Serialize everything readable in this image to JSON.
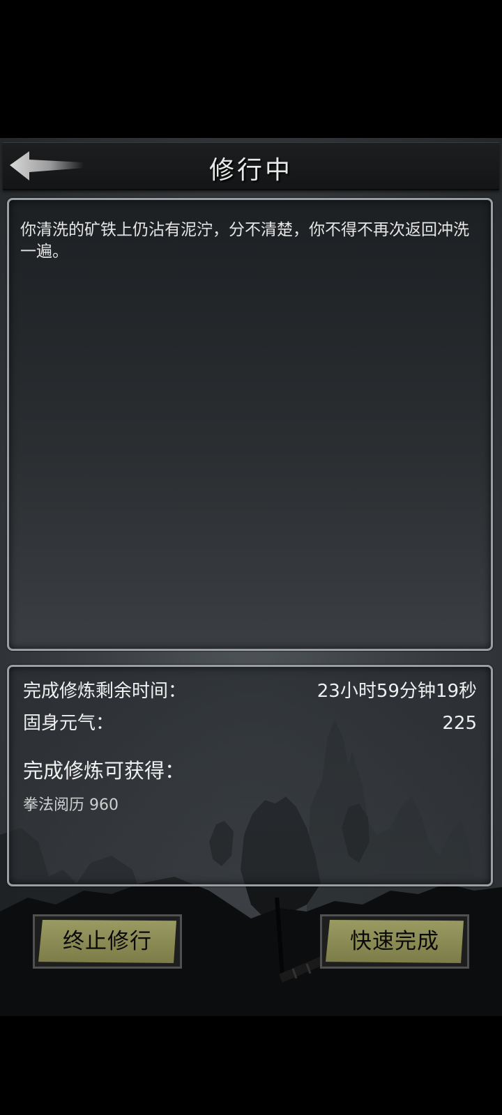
{
  "header": {
    "title": "修行中",
    "back_icon": "back-arrow-icon"
  },
  "story": {
    "text": "你清洗的矿铁上仍沾有泥泞，分不清楚，你不得不再次返回冲洗一遍。"
  },
  "status": {
    "time_label": "完成修炼剩余时间：",
    "time_value": "23小时59分钟19秒",
    "qi_label": "固身元气：",
    "qi_value": "225",
    "reward_title": "完成修炼可获得：",
    "reward_item": "拳法阅历 960"
  },
  "actions": {
    "stop_label": "终止修行",
    "fast_label": "快速完成"
  },
  "colors": {
    "button_face": "#8c8c57",
    "panel_border": "#9b9fa3",
    "text": "#f0f0f0"
  }
}
